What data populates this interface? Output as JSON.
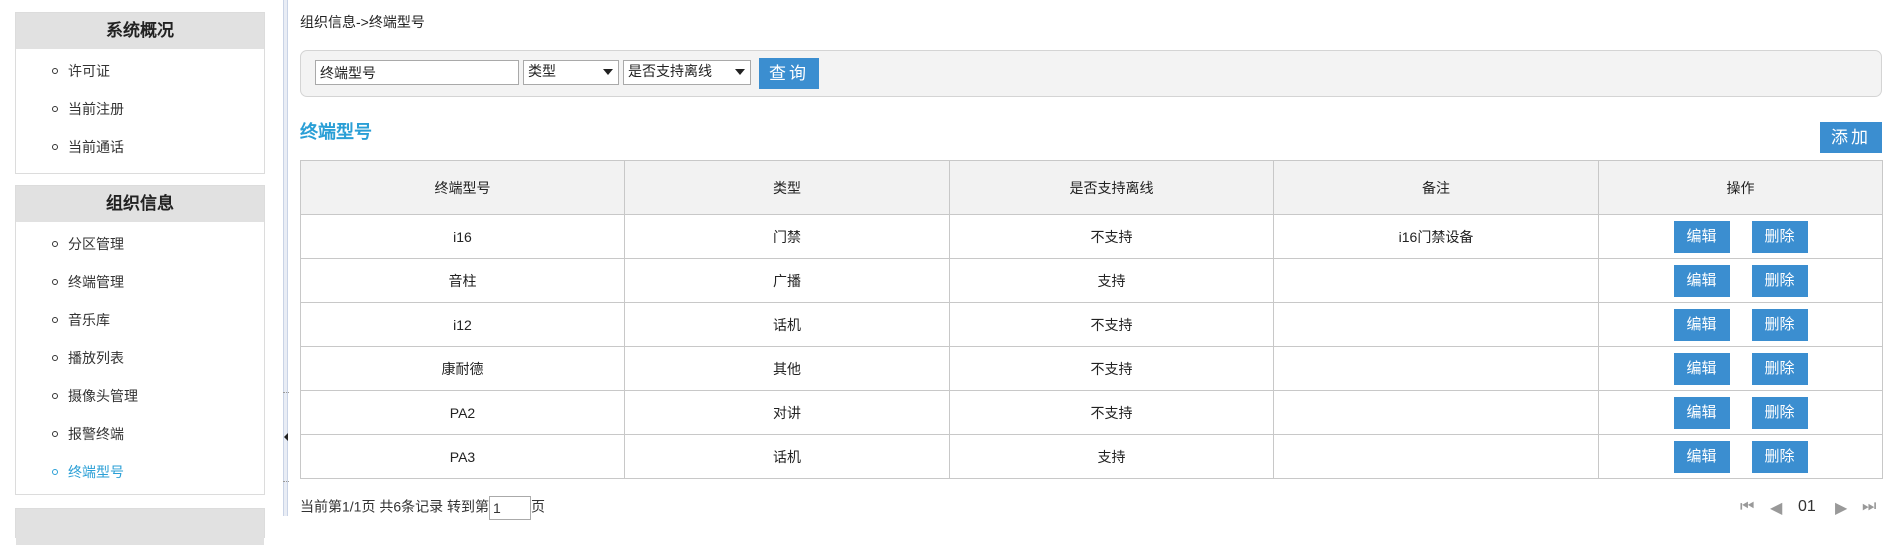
{
  "sidebar": {
    "panels": [
      {
        "title": "系统概况",
        "items": [
          "许可证",
          "当前注册",
          "当前通话"
        ]
      },
      {
        "title": "组织信息",
        "items": [
          "分区管理",
          "终端管理",
          "音乐库",
          "播放列表",
          "摄像头管理",
          "报警终端",
          "终端型号"
        ]
      }
    ],
    "active_item": "终端型号"
  },
  "breadcrumb": "组织信息->终端型号",
  "search": {
    "model_value": "终端型号",
    "type_selected": "类型",
    "offline_selected": "是否支持离线",
    "query_label": "查询"
  },
  "section": {
    "title": "终端型号",
    "add_label": "添加"
  },
  "table": {
    "headers": [
      "终端型号",
      "类型",
      "是否支持离线",
      "备注",
      "操作"
    ],
    "rows": [
      {
        "model": "i16",
        "type": "门禁",
        "offline": "不支持",
        "note": "i16门禁设备"
      },
      {
        "model": "音柱",
        "type": "广播",
        "offline": "支持",
        "note": ""
      },
      {
        "model": "i12",
        "type": "话机",
        "offline": "不支持",
        "note": ""
      },
      {
        "model": "康耐德",
        "type": "其他",
        "offline": "不支持",
        "note": ""
      },
      {
        "model": "PA2",
        "type": "对讲",
        "offline": "不支持",
        "note": ""
      },
      {
        "model": "PA3",
        "type": "话机",
        "offline": "支持",
        "note": ""
      }
    ],
    "edit_label": "编辑",
    "delete_label": "删除"
  },
  "footer": {
    "status_text": "当前第1/1页 共6条记录 转到第",
    "page_input": "1",
    "page_suffix": "页"
  },
  "pager": {
    "first": "⏮",
    "prev": "◀",
    "current": "01",
    "next": "▶",
    "last": "⏭"
  }
}
